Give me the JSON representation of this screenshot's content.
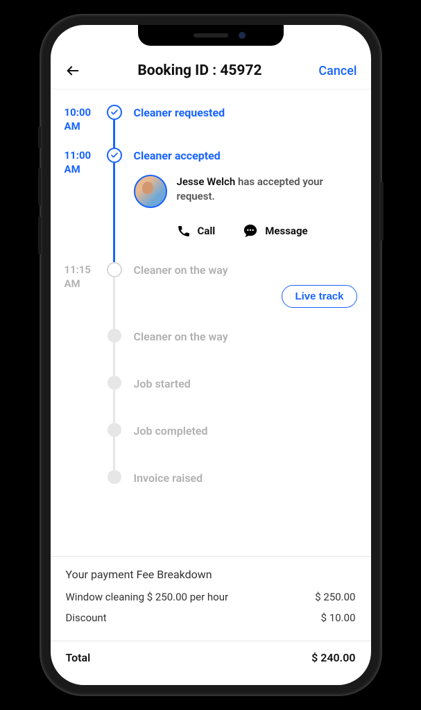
{
  "header": {
    "title": "Booking ID : 45972",
    "cancel_label": "Cancel"
  },
  "timeline": [
    {
      "time_1": "10:00",
      "time_2": "AM",
      "label": "Cleaner requested",
      "state": "done"
    },
    {
      "time_1": "11:00",
      "time_2": "AM",
      "label": "Cleaner accepted",
      "state": "done"
    },
    {
      "time_1": "11:15",
      "time_2": "AM",
      "label": "Cleaner on the way",
      "state": "pending-ring"
    },
    {
      "time_1": "",
      "time_2": "",
      "label": "Cleaner on the way",
      "state": "pending-dot"
    },
    {
      "time_1": "",
      "time_2": "",
      "label": "Job started",
      "state": "pending-dot"
    },
    {
      "time_1": "",
      "time_2": "",
      "label": "Job completed",
      "state": "pending-dot"
    },
    {
      "time_1": "",
      "time_2": "",
      "label": "Invoice raised",
      "state": "pending-dot"
    }
  ],
  "accepted": {
    "cleaner_name": "Jesse Welch",
    "suffix_text": " has accepted your request.",
    "call_label": "Call",
    "message_label": "Message"
  },
  "live_track_label": "Live track",
  "fees": {
    "title": "Your payment Fee Breakdown",
    "line1_label": "Window cleaning $ 250.00 per hour",
    "line1_amount": "$ 250.00",
    "line2_label": "Discount",
    "line2_amount": "$ 10.00"
  },
  "total": {
    "label": "Total",
    "amount": "$ 240.00"
  }
}
